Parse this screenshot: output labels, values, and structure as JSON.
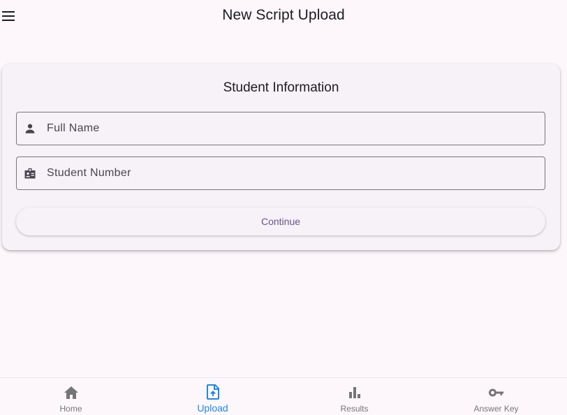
{
  "appbar": {
    "title": "New Script Upload",
    "menu_icon": "menu-icon"
  },
  "form": {
    "title": "Student Information",
    "full_name": {
      "placeholder": "Full Name",
      "value": "",
      "icon": "person-icon"
    },
    "student_number": {
      "placeholder": "Student Number",
      "value": "",
      "icon": "badge-icon"
    },
    "continue_label": "Continue"
  },
  "bottom_nav": {
    "active": "Upload",
    "items": [
      {
        "label": "Home",
        "icon": "home-icon"
      },
      {
        "label": "Upload",
        "icon": "upload-file-icon"
      },
      {
        "label": "Results",
        "icon": "bar-chart-icon"
      },
      {
        "label": "Answer Key",
        "icon": "key-icon"
      }
    ]
  },
  "colors": {
    "background": "#fdf7fc",
    "card": "#f7f1f8",
    "primary_text": "#1d1b20",
    "button_text": "#65558f",
    "nav_active": "#1e88e5",
    "nav_inactive": "#757575"
  }
}
